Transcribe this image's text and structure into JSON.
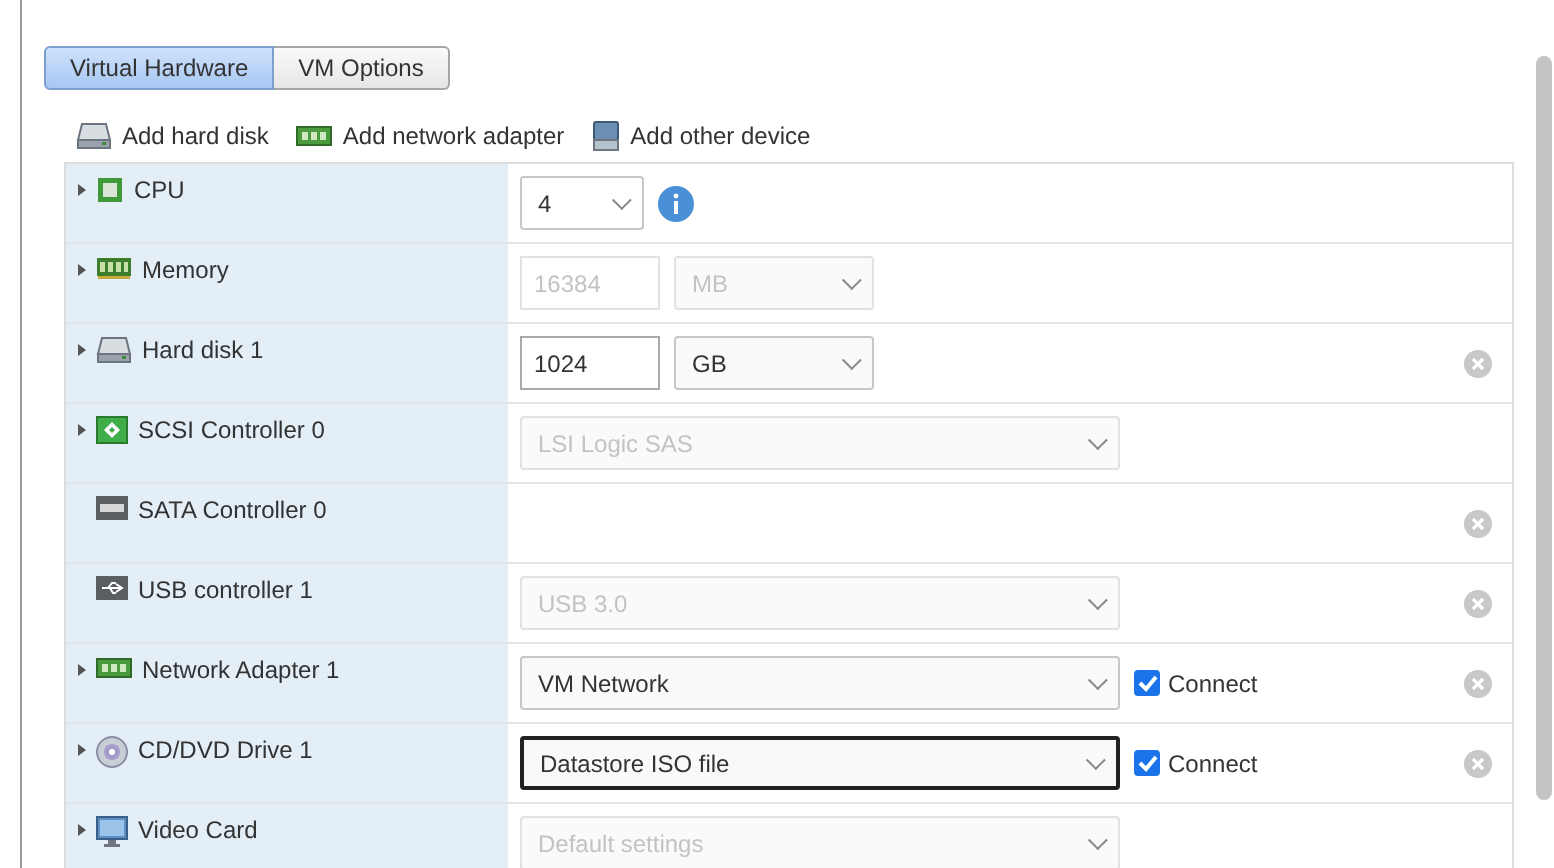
{
  "tabs": [
    {
      "label": "Virtual Hardware",
      "selected": true
    },
    {
      "label": "VM Options",
      "selected": false
    }
  ],
  "toolbar": [
    {
      "label": "Add hard disk"
    },
    {
      "label": "Add network adapter"
    },
    {
      "label": "Add other device"
    }
  ],
  "rows": [
    {
      "label": "CPU",
      "expandable": true,
      "removable": false,
      "controls": [
        {
          "kind": "select",
          "value": "4",
          "disabled": false,
          "focused": false
        },
        {
          "kind": "info"
        }
      ]
    },
    {
      "label": "Memory",
      "expandable": true,
      "removable": false,
      "controls": [
        {
          "kind": "input",
          "value": "16384",
          "disabled": true
        },
        {
          "kind": "select",
          "value": "MB",
          "disabled": true,
          "focused": false
        }
      ]
    },
    {
      "label": "Hard disk 1",
      "expandable": true,
      "removable": true,
      "controls": [
        {
          "kind": "input",
          "value": "1024",
          "disabled": false
        },
        {
          "kind": "select",
          "value": "GB",
          "disabled": false,
          "focused": false
        }
      ]
    },
    {
      "label": "SCSI Controller 0",
      "expandable": true,
      "removable": false,
      "controls": [
        {
          "kind": "select",
          "value": "LSI Logic SAS",
          "disabled": true,
          "focused": false
        }
      ]
    },
    {
      "label": "SATA Controller 0",
      "expandable": false,
      "removable": true,
      "controls": []
    },
    {
      "label": "USB controller 1",
      "expandable": false,
      "removable": true,
      "controls": [
        {
          "kind": "select",
          "value": "USB 3.0",
          "disabled": true,
          "focused": false
        }
      ]
    },
    {
      "label": "Network Adapter 1",
      "expandable": true,
      "removable": true,
      "controls": [
        {
          "kind": "select",
          "value": "VM Network",
          "disabled": false,
          "focused": false
        },
        {
          "kind": "checkbox",
          "label": "Connect",
          "checked": true
        }
      ]
    },
    {
      "label": "CD/DVD Drive 1",
      "expandable": true,
      "removable": true,
      "controls": [
        {
          "kind": "select",
          "value": "Datastore ISO file",
          "disabled": false,
          "focused": true
        },
        {
          "kind": "checkbox",
          "label": "Connect",
          "checked": true
        }
      ]
    },
    {
      "label": "Video Card",
      "expandable": true,
      "removable": false,
      "controls": [
        {
          "kind": "select",
          "value": "Default settings",
          "disabled": true,
          "focused": false
        }
      ]
    }
  ]
}
